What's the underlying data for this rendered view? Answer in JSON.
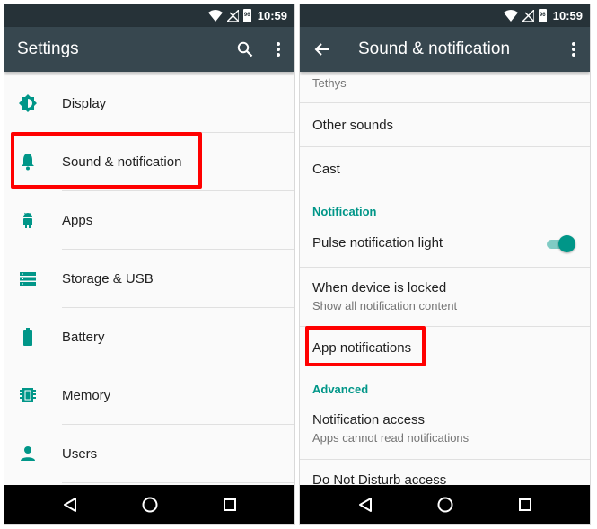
{
  "colors": {
    "accent": "#009688",
    "toolbar": "#37474f",
    "status_bar": "#263238",
    "highlight": "#ff0000"
  },
  "status_bar": {
    "time": "10:59",
    "battery_level": "96",
    "icons": [
      "wifi-icon",
      "no-signal-icon",
      "battery-icon"
    ]
  },
  "left_screen": {
    "title": "Settings",
    "actions": [
      "search-icon",
      "more-vert-icon"
    ],
    "items": [
      {
        "label": "Display",
        "icon": "brightness-icon"
      },
      {
        "label": "Sound & notification",
        "icon": "bell-icon",
        "highlighted": true
      },
      {
        "label": "Apps",
        "icon": "android-icon"
      },
      {
        "label": "Storage & USB",
        "icon": "storage-icon"
      },
      {
        "label": "Battery",
        "icon": "battery-icon"
      },
      {
        "label": "Memory",
        "icon": "memory-chip-icon"
      },
      {
        "label": "Users",
        "icon": "person-icon"
      }
    ]
  },
  "right_screen": {
    "title": "Sound & notification",
    "partial_summary": "Tethys",
    "other_sounds": "Other sounds",
    "cast": "Cast",
    "notification_header": "Notification",
    "pulse_light": {
      "label": "Pulse notification light",
      "enabled": true
    },
    "when_locked": {
      "label": "When device is locked",
      "summary": "Show all notification content"
    },
    "app_notifications": {
      "label": "App notifications",
      "highlighted": true
    },
    "advanced_header": "Advanced",
    "notification_access": {
      "label": "Notification access",
      "summary": "Apps cannot read notifications"
    },
    "dnd_access": "Do Not Disturb access"
  },
  "nav_bar": [
    "back-icon",
    "home-icon",
    "recents-icon"
  ]
}
